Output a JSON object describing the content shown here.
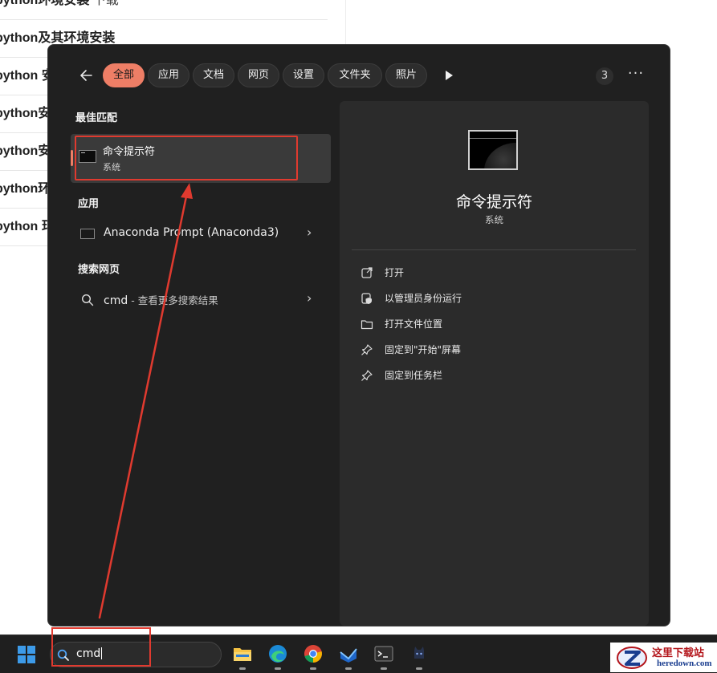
{
  "background_page": {
    "items": [
      {
        "bold": "python环境安装",
        "light": " 下载"
      },
      {
        "bold": "python及其环境安装",
        "light": ""
      },
      {
        "bold": "python 安",
        "light": ""
      },
      {
        "bold": "python安",
        "light": ""
      },
      {
        "bold": "python安",
        "light": ""
      },
      {
        "bold": "python环",
        "light": ""
      },
      {
        "bold": "python 玎",
        "light": ""
      }
    ]
  },
  "start_menu": {
    "filters": [
      {
        "label": "全部",
        "active": true
      },
      {
        "label": "应用",
        "active": false
      },
      {
        "label": "文档",
        "active": false
      },
      {
        "label": "网页",
        "active": false
      },
      {
        "label": "设置",
        "active": false
      },
      {
        "label": "文件夹",
        "active": false
      },
      {
        "label": "照片",
        "active": false
      }
    ],
    "count": "3",
    "more": "···",
    "best_match": {
      "section_title": "最佳匹配",
      "name": "命令提示符",
      "subtitle": "系统"
    },
    "apps": {
      "section_title": "应用",
      "items": [
        {
          "name": "Anaconda Prompt (Anaconda3)",
          "icon": "terminal-icon"
        }
      ]
    },
    "web": {
      "section_title": "搜索网页",
      "query": "cmd",
      "suffix": " - 查看更多搜索结果"
    },
    "preview": {
      "title": "命令提示符",
      "subtitle": "系统",
      "actions": [
        {
          "label": "打开",
          "icon": "open-external-icon"
        },
        {
          "label": "以管理员身份运行",
          "icon": "admin-shield-icon"
        },
        {
          "label": "打开文件位置",
          "icon": "folder-icon"
        },
        {
          "label": "固定到\"开始\"屏幕",
          "icon": "pin-icon"
        },
        {
          "label": "固定到任务栏",
          "icon": "pin-icon"
        }
      ]
    }
  },
  "taskbar": {
    "search_value": "cmd",
    "apps": [
      "file-explorer-icon",
      "edge-icon",
      "chrome-icon",
      "app-icon",
      "terminal-icon",
      "cat-app-icon"
    ]
  },
  "watermark": {
    "text_cn": "这里下载站",
    "text_url": "heredown.com"
  },
  "colors": {
    "accent": "#ee7e66",
    "annotation_red": "#e03a2f",
    "menu_bg": "#202020",
    "pane_bg": "#2b2b2b"
  }
}
